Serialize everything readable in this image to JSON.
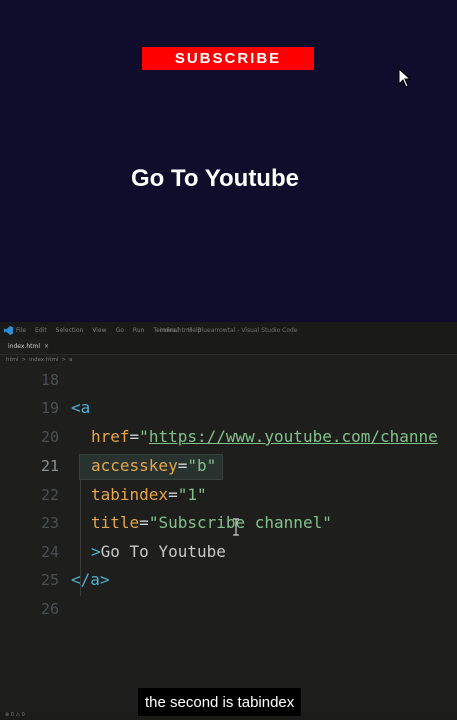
{
  "preview": {
    "subscribe_label": "SUBSCRIBE",
    "link_text": "Go To Youtube",
    "background_color": "#0f0d2b",
    "button_color": "#ff0000"
  },
  "editor": {
    "menu": [
      "File",
      "Edit",
      "Selection",
      "View",
      "Go",
      "Run",
      "Terminal",
      "Help"
    ],
    "window_title": "index.html - Bluearrowtal - Visual Studio Code",
    "tab": {
      "label": "index.html",
      "close": "×"
    },
    "breadcrumb": [
      "html",
      ">",
      "index.html",
      ">",
      "a"
    ],
    "lines": [
      {
        "num": "18"
      },
      {
        "num": "19",
        "open": "<",
        "tagname": "a"
      },
      {
        "num": "20",
        "attr": "href",
        "eq": "=",
        "q1": "\"",
        "value": "https://www.youtube.com/channe"
      },
      {
        "num": "21",
        "attr": "accesskey",
        "eq": "=",
        "value": "\"b\""
      },
      {
        "num": "22",
        "attr": "tabindex",
        "eq": "=",
        "value": "\"1\""
      },
      {
        "num": "23",
        "attr": "title",
        "eq": "=",
        "value": "\"Subscribe channel\""
      },
      {
        "num": "24",
        "gt": ">",
        "text": "Go To Youtube"
      },
      {
        "num": "25",
        "close": "</",
        "tagname": "a",
        "gt": ">"
      },
      {
        "num": "26"
      }
    ],
    "status": "⊗ 0 ⚠ 0"
  },
  "caption": "the second is tabindex"
}
